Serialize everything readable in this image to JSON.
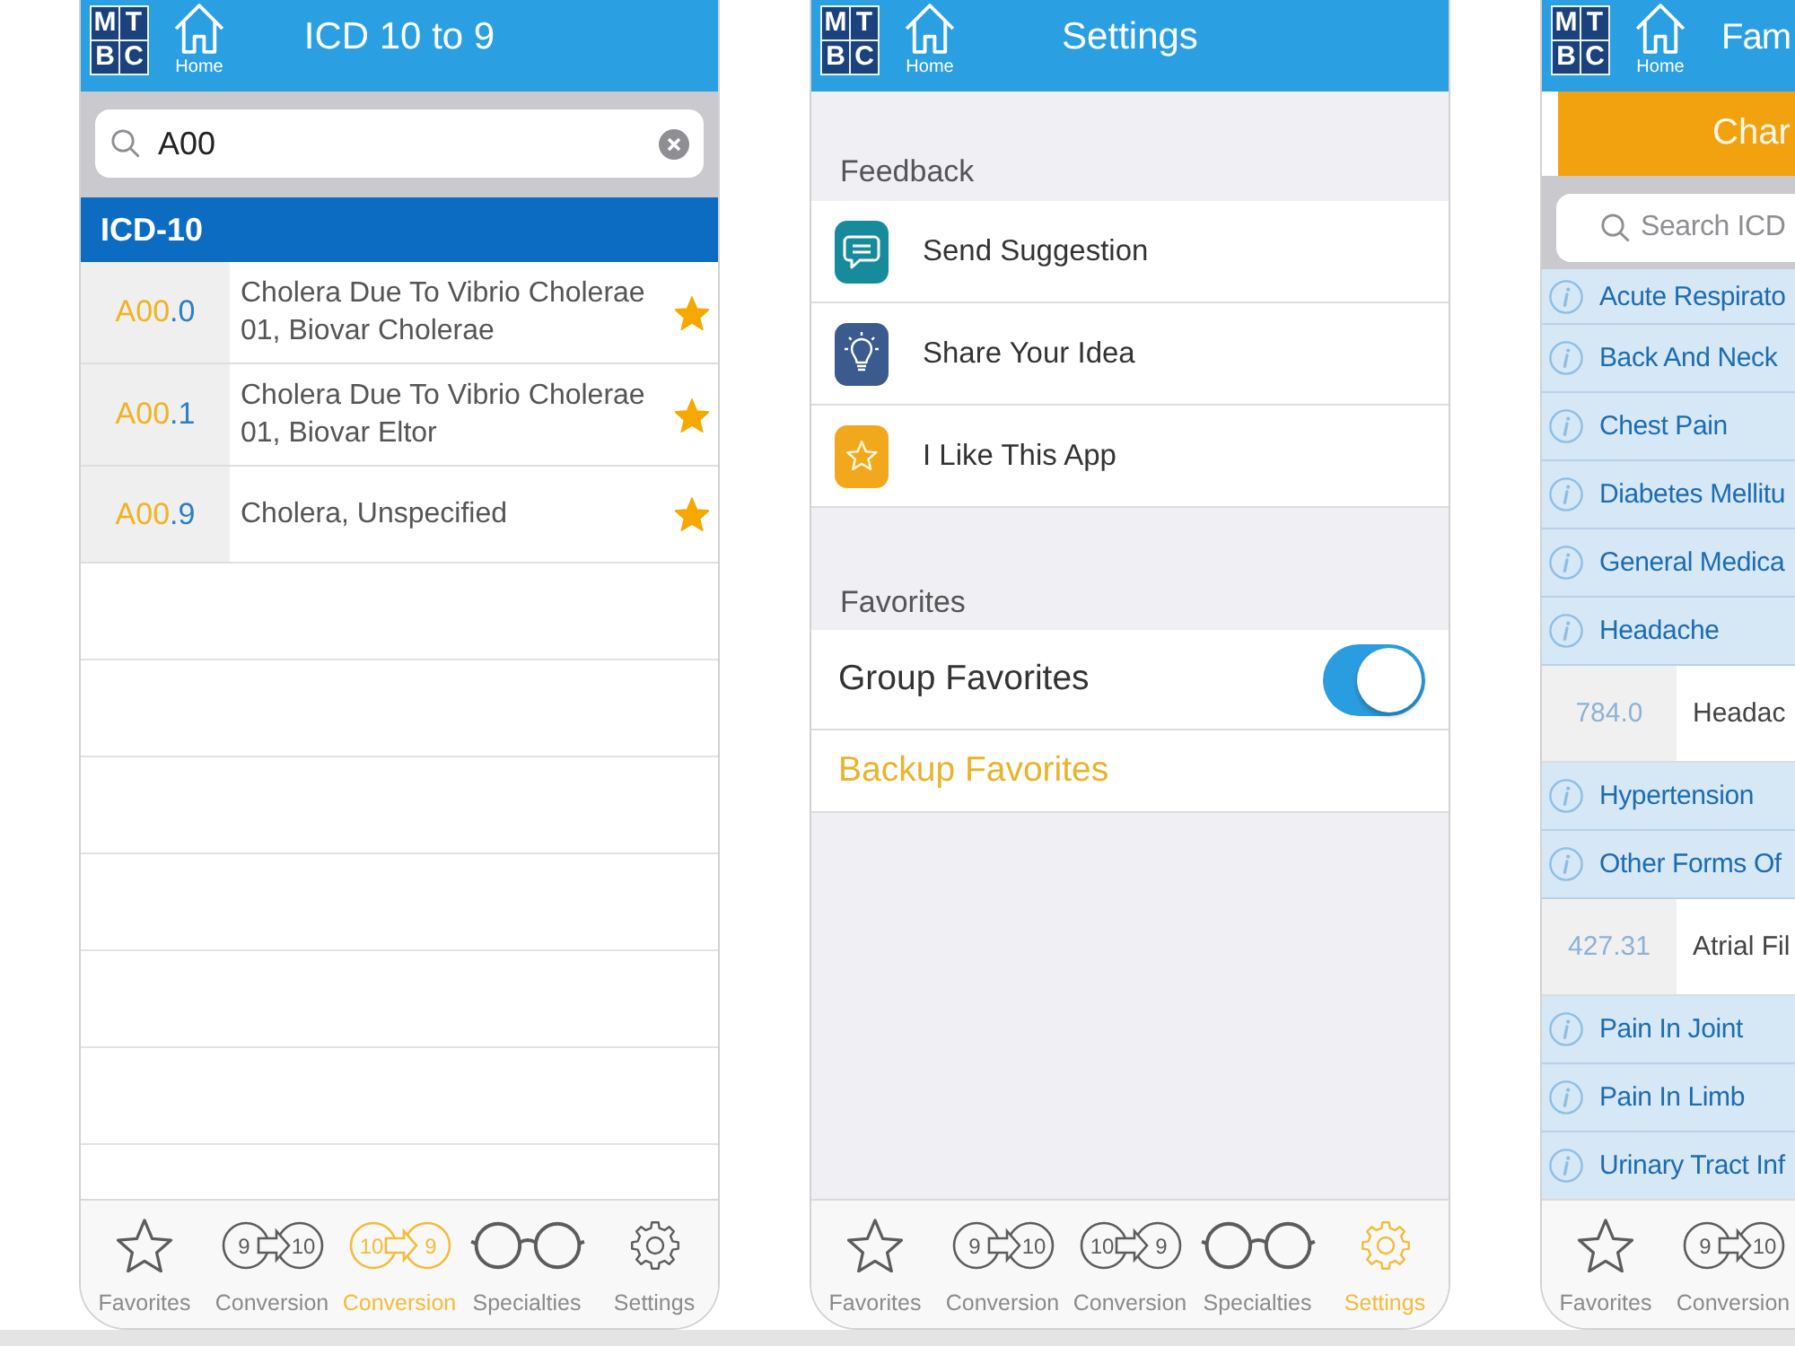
{
  "screens": [
    {
      "kind": "icd_lookup",
      "header": {
        "logo": [
          "M",
          "T",
          "B",
          "C"
        ],
        "home_label": "Home",
        "title": "ICD 10 to 9"
      },
      "search": {
        "value": "A00"
      },
      "section_title": "ICD-10",
      "results": [
        {
          "code_prefix": "A00",
          "code_suffix": ".0",
          "description": "Cholera Due To Vibrio Cholerae 01, Biovar Cholerae",
          "favorite": true
        },
        {
          "code_prefix": "A00",
          "code_suffix": ".1",
          "description": "Cholera Due To Vibrio Cholerae 01, Biovar Eltor",
          "favorite": true
        },
        {
          "code_prefix": "A00",
          "code_suffix": ".9",
          "description": "Cholera, Unspecified",
          "favorite": true
        }
      ],
      "tabs": [
        {
          "kind": "favorites",
          "label": "Favorites",
          "selected": false
        },
        {
          "kind": "conversion",
          "icon_from": "9",
          "icon_to": "10",
          "label": "Conversion",
          "selected": false
        },
        {
          "kind": "conversion",
          "icon_from": "10",
          "icon_to": "9",
          "label": "Conversion",
          "selected": true
        },
        {
          "kind": "specialties",
          "label": "Specialties",
          "selected": false
        },
        {
          "kind": "settings",
          "label": "Settings",
          "selected": false
        }
      ]
    },
    {
      "kind": "settings",
      "header": {
        "logo": [
          "M",
          "T",
          "B",
          "C"
        ],
        "home_label": "Home",
        "title": "Settings"
      },
      "sections": [
        {
          "title": "Feedback",
          "items": [
            {
              "kind": "icon_link",
              "label": "Send Suggestion",
              "color": "#178b9b"
            },
            {
              "kind": "icon_link",
              "label": "Share Your Idea",
              "color": "#3b5a8d"
            },
            {
              "kind": "icon_link",
              "label": "I Like This App",
              "color": "#f2a81d"
            }
          ]
        },
        {
          "title": "Favorites",
          "items": [
            {
              "kind": "toggle",
              "label": "Group Favorites",
              "on": true
            },
            {
              "kind": "action",
              "label": "Backup Favorites"
            }
          ]
        }
      ],
      "tabs": [
        {
          "kind": "favorites",
          "label": "Favorites",
          "selected": false
        },
        {
          "kind": "conversion",
          "icon_from": "9",
          "icon_to": "10",
          "label": "Conversion",
          "selected": false
        },
        {
          "kind": "conversion",
          "icon_from": "10",
          "icon_to": "9",
          "label": "Conversion",
          "selected": false
        },
        {
          "kind": "specialties",
          "label": "Specialties",
          "selected": false
        },
        {
          "kind": "settings",
          "label": "Settings",
          "selected": true
        }
      ]
    },
    {
      "kind": "specialty_list",
      "header": {
        "logo": [
          "M",
          "T",
          "B",
          "C"
        ],
        "home_label": "Home",
        "title": "Fam"
      },
      "banner": "Char",
      "search": {
        "placeholder": "Search ICD"
      },
      "items": [
        {
          "kind": "group",
          "label": "Acute Respirato"
        },
        {
          "kind": "group",
          "label": "Back And Neck"
        },
        {
          "kind": "group",
          "label": "Chest Pain"
        },
        {
          "kind": "group",
          "label": "Diabetes Mellitu"
        },
        {
          "kind": "group",
          "label": "General Medica"
        },
        {
          "kind": "group",
          "label": "Headache"
        },
        {
          "kind": "code",
          "code": "784.0",
          "description": "Headac"
        },
        {
          "kind": "group",
          "label": "Hypertension"
        },
        {
          "kind": "group",
          "label": "Other Forms Of"
        },
        {
          "kind": "code",
          "code": "427.31",
          "description": "Atrial Fil"
        },
        {
          "kind": "group",
          "label": "Pain In Joint"
        },
        {
          "kind": "group",
          "label": "Pain In Limb"
        },
        {
          "kind": "group",
          "label": "Urinary Tract Inf"
        }
      ],
      "tabs": [
        {
          "kind": "favorites",
          "label": "Favorites",
          "selected": false
        },
        {
          "kind": "conversion",
          "icon_from": "9",
          "icon_to": "10",
          "label": "Conversion",
          "selected": false
        }
      ]
    }
  ]
}
